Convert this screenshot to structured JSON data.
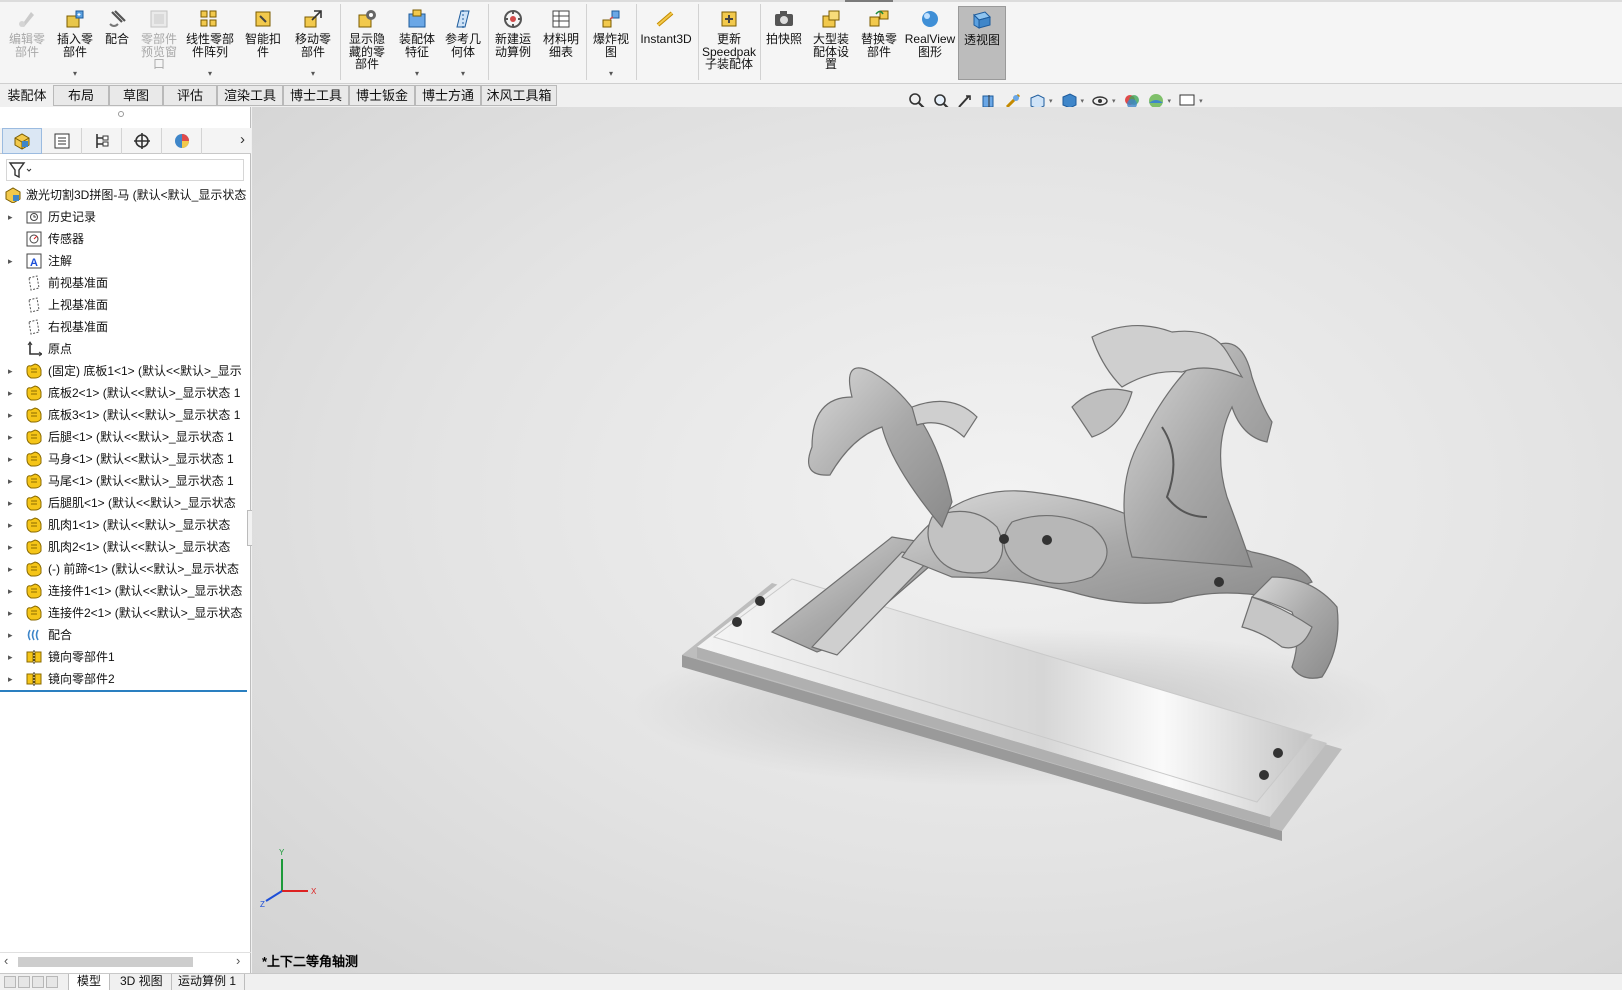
{
  "ribbon": {
    "buttons": [
      {
        "id": "edit-component",
        "label": "编辑零\n部件",
        "icon": "edit-component-icon",
        "disabled": true,
        "dropdown": false
      },
      {
        "id": "insert-component",
        "label": "插入零\n部件",
        "icon": "insert-component-icon",
        "disabled": false,
        "dropdown": true
      },
      {
        "id": "mate",
        "label": "配合",
        "icon": "mate-icon",
        "disabled": false,
        "dropdown": false
      },
      {
        "id": "component-preview",
        "label": "零部件\n预览窗\n口",
        "icon": "preview-window-icon",
        "disabled": true,
        "dropdown": false
      },
      {
        "id": "linear-pattern",
        "label": "线性零部\n件阵列",
        "icon": "linear-pattern-icon",
        "disabled": false,
        "dropdown": true
      },
      {
        "id": "smart-fasteners",
        "label": "智能扣\n件",
        "icon": "smart-fasteners-icon",
        "disabled": false,
        "dropdown": false
      },
      {
        "id": "move-component",
        "label": "移动零\n部件",
        "icon": "move-component-icon",
        "disabled": false,
        "dropdown": true
      },
      {
        "id": "show-hidden",
        "label": "显示隐\n藏的零\n部件",
        "icon": "show-hidden-icon",
        "disabled": false,
        "dropdown": false
      },
      {
        "id": "assembly-features",
        "label": "装配体\n特征",
        "icon": "assembly-features-icon",
        "disabled": false,
        "dropdown": true
      },
      {
        "id": "reference-geometry",
        "label": "参考几\n何体",
        "icon": "reference-geometry-icon",
        "disabled": false,
        "dropdown": true
      },
      {
        "id": "new-motion-study",
        "label": "新建运\n动算例",
        "icon": "motion-study-icon",
        "disabled": false,
        "dropdown": false
      },
      {
        "id": "bom",
        "label": "材料明\n细表",
        "icon": "bom-icon",
        "disabled": false,
        "dropdown": false
      },
      {
        "id": "exploded-view",
        "label": "爆炸视\n图",
        "icon": "exploded-view-icon",
        "disabled": false,
        "dropdown": true
      },
      {
        "id": "instant3d",
        "label": "Instant3D",
        "icon": "instant3d-icon",
        "disabled": false,
        "dropdown": false
      },
      {
        "id": "update-speedpak",
        "label": "更新\nSpeedpak\n子装配体",
        "icon": "speedpak-icon",
        "disabled": false,
        "dropdown": false
      },
      {
        "id": "snapshot",
        "label": "拍快照",
        "icon": "camera-icon",
        "disabled": false,
        "dropdown": false
      },
      {
        "id": "large-assembly",
        "label": "大型装\n配体设\n置",
        "icon": "large-assembly-icon",
        "disabled": false,
        "dropdown": false
      },
      {
        "id": "replace-components",
        "label": "替换零\n部件",
        "icon": "replace-components-icon",
        "disabled": false,
        "dropdown": false
      },
      {
        "id": "realview",
        "label": "RealView\n图形",
        "icon": "realview-icon",
        "disabled": false,
        "dropdown": false
      },
      {
        "id": "perspective",
        "label": "透视图",
        "icon": "perspective-icon",
        "disabled": false,
        "dropdown": false,
        "active": true
      }
    ]
  },
  "command_tabs": [
    "装配体",
    "布局",
    "草图",
    "评估",
    "渲染工具",
    "博士工具",
    "博士钣金",
    "博士方通",
    "沐风工具箱"
  ],
  "heads_up_toolbar": [
    "zoom-to-fit-icon",
    "zoom-to-area-icon",
    "previous-view-icon",
    "section-view-icon",
    "dynamic-annotation-icon",
    "view-orientation-icon",
    "display-style-icon",
    "hide-show-icon",
    "edit-appearance-icon",
    "apply-scene-icon",
    "view-settings-icon"
  ],
  "feature_tree": {
    "root": "激光切割3D拼图-马  (默认<默认_显示状态",
    "items": [
      {
        "label": "历史记录",
        "icon": "history-icon",
        "expandable": true
      },
      {
        "label": "传感器",
        "icon": "sensor-icon",
        "expandable": false
      },
      {
        "label": "注解",
        "icon": "annotations-icon",
        "expandable": true
      },
      {
        "label": "前视基准面",
        "icon": "plane-icon",
        "expandable": false
      },
      {
        "label": "上视基准面",
        "icon": "plane-icon",
        "expandable": false
      },
      {
        "label": "右视基准面",
        "icon": "plane-icon",
        "expandable": false
      },
      {
        "label": "原点",
        "icon": "origin-icon",
        "expandable": false
      },
      {
        "label": "(固定) 底板1<1> (默认<<默认>_显示",
        "icon": "part-icon",
        "expandable": true
      },
      {
        "label": "底板2<1> (默认<<默认>_显示状态 1",
        "icon": "part-icon",
        "expandable": true
      },
      {
        "label": "底板3<1> (默认<<默认>_显示状态 1",
        "icon": "part-icon",
        "expandable": true
      },
      {
        "label": "后腿<1> (默认<<默认>_显示状态 1",
        "icon": "part-icon",
        "expandable": true
      },
      {
        "label": "马身<1> (默认<<默认>_显示状态 1",
        "icon": "part-icon",
        "expandable": true
      },
      {
        "label": "马尾<1> (默认<<默认>_显示状态 1",
        "icon": "part-icon",
        "expandable": true
      },
      {
        "label": "后腿肌<1> (默认<<默认>_显示状态",
        "icon": "part-icon",
        "expandable": true
      },
      {
        "label": "肌肉1<1> (默认<<默认>_显示状态",
        "icon": "part-icon",
        "expandable": true
      },
      {
        "label": "肌肉2<1> (默认<<默认>_显示状态",
        "icon": "part-icon",
        "expandable": true
      },
      {
        "label": "(-) 前蹄<1> (默认<<默认>_显示状态",
        "icon": "part-icon",
        "expandable": true
      },
      {
        "label": "连接件1<1> (默认<<默认>_显示状态",
        "icon": "part-icon",
        "expandable": true
      },
      {
        "label": "连接件2<1> (默认<<默认>_显示状态",
        "icon": "part-icon",
        "expandable": true
      },
      {
        "label": "配合",
        "icon": "mates-icon",
        "expandable": true
      },
      {
        "label": "镜向零部件1",
        "icon": "mirror-component-icon",
        "expandable": true
      },
      {
        "label": "镜向零部件2",
        "icon": "mirror-component-icon",
        "expandable": true
      }
    ]
  },
  "viewport": {
    "view_label": "*上下二等角轴测",
    "triad": {
      "x": "X",
      "y": "Y",
      "z": "Z"
    }
  },
  "bottom_tabs": [
    "模型",
    "3D 视图",
    "运动算例 1"
  ],
  "colors": {
    "accent": "#2a7fc0",
    "part_icon": "#f5c518",
    "ribbon_active": "#bcbcbc"
  }
}
